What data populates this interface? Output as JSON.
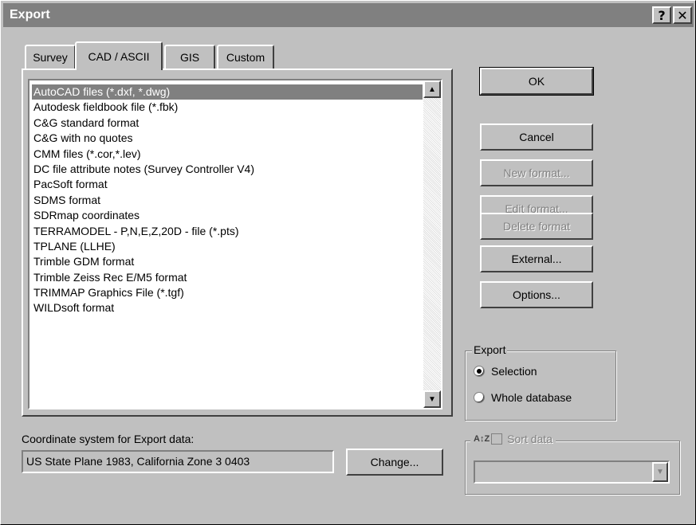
{
  "window": {
    "title": "Export",
    "help_btn": "?",
    "close_btn": "✕"
  },
  "tabs": [
    {
      "label": "Survey",
      "active": false
    },
    {
      "label": "CAD / ASCII",
      "active": true
    },
    {
      "label": "GIS",
      "active": false
    },
    {
      "label": "Custom",
      "active": false
    }
  ],
  "formats": [
    "AutoCAD files (*.dxf, *.dwg)",
    "Autodesk fieldbook file (*.fbk)",
    "C&G standard format",
    "C&G with no quotes",
    "CMM files (*.cor,*.lev)",
    "DC file attribute notes (Survey Controller V4)",
    "PacSoft format",
    "SDMS format",
    "SDRmap coordinates",
    "TERRAMODEL - P,N,E,Z,20D - file (*.pts)",
    "TPLANE (LLHE)",
    "Trimble GDM format",
    "Trimble Zeiss Rec E/M5 format",
    "TRIMMAP Graphics File (*.tgf)",
    "WILDsoft format"
  ],
  "selected_format": "AutoCAD files (*.dxf, *.dwg)",
  "buttons": {
    "ok": "OK",
    "cancel": "Cancel",
    "new_format": "New format...",
    "edit_format": "Edit format...",
    "delete_format": "Delete format",
    "external": "External...",
    "options": "Options...",
    "change": "Change..."
  },
  "export_group": {
    "label": "Export",
    "selection": "Selection",
    "whole_database": "Whole database",
    "selected": "Selection"
  },
  "coord": {
    "label": "Coordinate system for Export data:",
    "value": "US State Plane 1983, California Zone 3 0403"
  },
  "sort": {
    "label": "Sort data",
    "checked": false,
    "enabled": false,
    "icon": "sort-az-icon",
    "dropdown_value": ""
  }
}
